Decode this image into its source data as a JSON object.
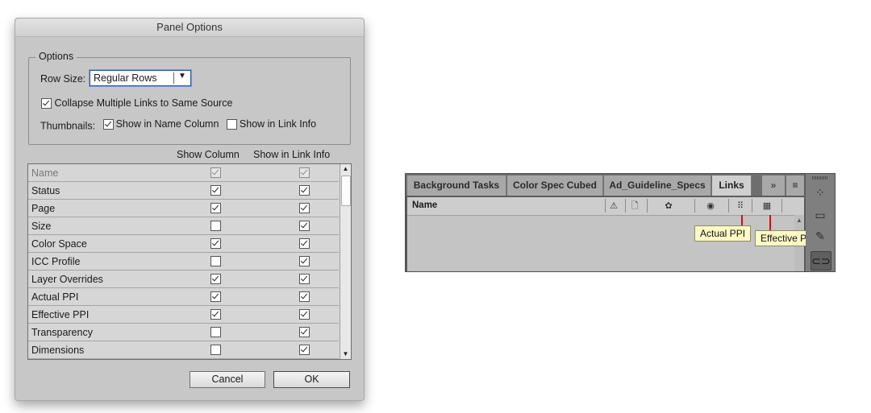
{
  "dialog": {
    "title": "Panel Options",
    "options_legend": "Options",
    "row_size_label": "Row Size:",
    "row_size_value": "Regular Rows",
    "collapse_label": "Collapse Multiple Links to Same Source",
    "collapse_checked": true,
    "thumbnails_label": "Thumbnails:",
    "thumb_name_label": "Show in Name Column",
    "thumb_name_checked": true,
    "thumb_info_label": "Show in Link Info",
    "thumb_info_checked": false,
    "col_header_show_column": "Show Column",
    "col_header_show_info": "Show in Link Info",
    "rows": [
      {
        "name": "Name",
        "show_column": true,
        "show_info": true,
        "disabled": true
      },
      {
        "name": "Status",
        "show_column": true,
        "show_info": true
      },
      {
        "name": "Page",
        "show_column": true,
        "show_info": true
      },
      {
        "name": "Size",
        "show_column": false,
        "show_info": true
      },
      {
        "name": "Color Space",
        "show_column": true,
        "show_info": true
      },
      {
        "name": "ICC Profile",
        "show_column": false,
        "show_info": true
      },
      {
        "name": "Layer Overrides",
        "show_column": true,
        "show_info": true
      },
      {
        "name": "Actual PPI",
        "show_column": true,
        "show_info": true
      },
      {
        "name": "Effective PPI",
        "show_column": true,
        "show_info": true
      },
      {
        "name": "Transparency",
        "show_column": false,
        "show_info": true
      },
      {
        "name": "Dimensions",
        "show_column": false,
        "show_info": true
      }
    ],
    "cancel_label": "Cancel",
    "ok_label": "OK"
  },
  "links_panel": {
    "tabs": [
      "Background Tasks",
      "Color Spec Cubed",
      "Ad_Guideline_Specs",
      "Links"
    ],
    "active_tab": "Links",
    "overflow_glyph": "»",
    "menu_glyph": "≡",
    "name_column": "Name",
    "column_icons": [
      "warning-icon",
      "page-icon",
      "palette-icon",
      "eye-icon",
      "actual-ppi-icon",
      "effective-ppi-icon"
    ],
    "callout_actual": "Actual PPI",
    "callout_effective": "Effective PPI",
    "callout_color": "#d21010",
    "dock_icons": [
      "color-wheel-icon",
      "image-icon",
      "brush-icon",
      "link-icon"
    ]
  }
}
